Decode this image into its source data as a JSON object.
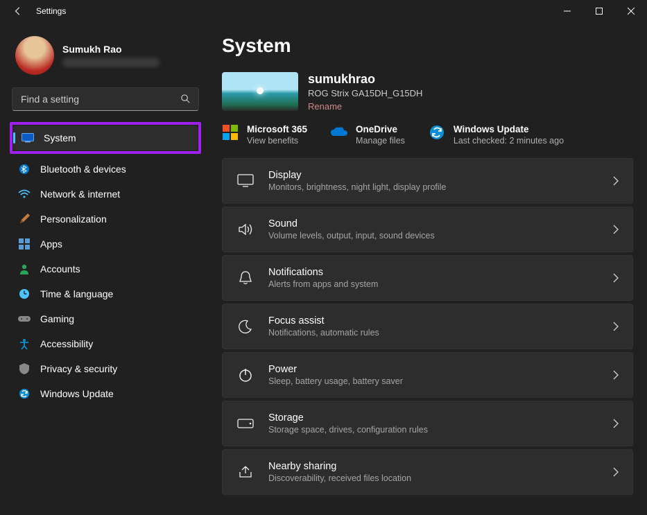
{
  "window": {
    "title": "Settings"
  },
  "user": {
    "name": "Sumukh Rao"
  },
  "search": {
    "placeholder": "Find a setting"
  },
  "nav": {
    "system": "System",
    "bluetooth": "Bluetooth & devices",
    "network": "Network & internet",
    "personalization": "Personalization",
    "apps": "Apps",
    "accounts": "Accounts",
    "time": "Time & language",
    "gaming": "Gaming",
    "accessibility": "Accessibility",
    "privacy": "Privacy & security",
    "update": "Windows Update"
  },
  "page": {
    "heading": "System",
    "device": {
      "hostname": "sumukhrao",
      "model": "ROG Strix GA15DH_G15DH",
      "rename": "Rename"
    },
    "status": {
      "m365": {
        "title": "Microsoft 365",
        "sub": "View benefits"
      },
      "onedrive": {
        "title": "OneDrive",
        "sub": "Manage files"
      },
      "update": {
        "title": "Windows Update",
        "sub": "Last checked: 2 minutes ago"
      }
    },
    "rows": [
      {
        "title": "Display",
        "sub": "Monitors, brightness, night light, display profile"
      },
      {
        "title": "Sound",
        "sub": "Volume levels, output, input, sound devices"
      },
      {
        "title": "Notifications",
        "sub": "Alerts from apps and system"
      },
      {
        "title": "Focus assist",
        "sub": "Notifications, automatic rules"
      },
      {
        "title": "Power",
        "sub": "Sleep, battery usage, battery saver"
      },
      {
        "title": "Storage",
        "sub": "Storage space, drives, configuration rules"
      },
      {
        "title": "Nearby sharing",
        "sub": "Discoverability, received files location"
      }
    ]
  }
}
